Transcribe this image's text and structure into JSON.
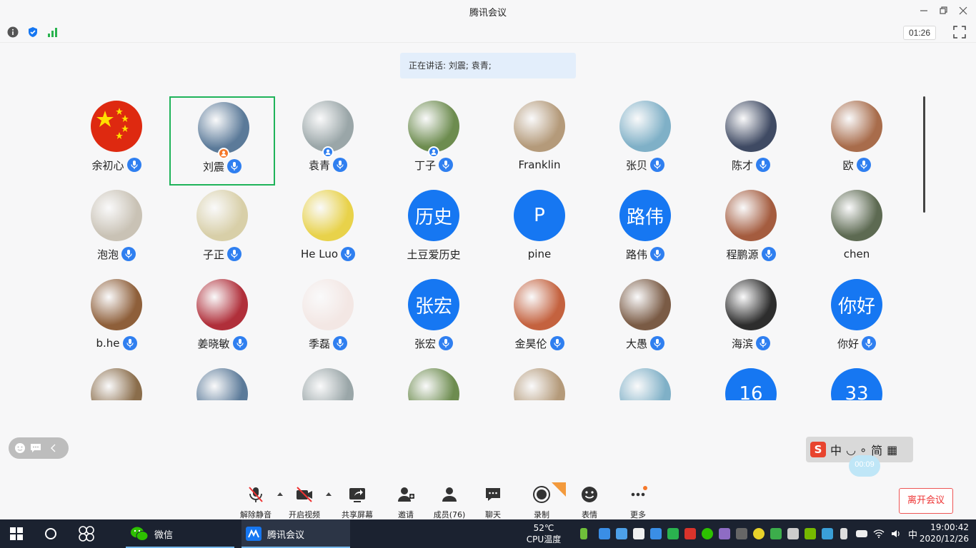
{
  "window": {
    "title": "腾讯会议"
  },
  "status": {
    "timer": "01:26"
  },
  "speaking": {
    "text": "正在讲话: 刘震; 袁青;"
  },
  "participants": [
    {
      "name": "余初心",
      "avatar": "flag",
      "mic": true
    },
    {
      "name": "刘震",
      "avatar": "photo",
      "mic": true,
      "active": true,
      "host": true
    },
    {
      "name": "袁青",
      "avatar": "photo",
      "mic": true,
      "cohost": true
    },
    {
      "name": "丁子",
      "avatar": "photo",
      "mic": true,
      "cohost": true
    },
    {
      "name": "Franklin",
      "avatar": "photo",
      "mic": false
    },
    {
      "name": "张贝",
      "avatar": "photo",
      "mic": true
    },
    {
      "name": "陈才",
      "avatar": "photo",
      "mic": true
    },
    {
      "name": "欧",
      "avatar": "photo",
      "mic": true
    },
    {
      "name": "泡泡",
      "avatar": "photo",
      "mic": true
    },
    {
      "name": "子正",
      "avatar": "photo",
      "mic": true
    },
    {
      "name": "He Luo",
      "avatar": "photo",
      "mic": true
    },
    {
      "name": "土豆爱历史",
      "avatar": "text",
      "initials": "历史",
      "mic": false
    },
    {
      "name": "pine",
      "avatar": "text",
      "initials": "P",
      "mic": false
    },
    {
      "name": "路伟",
      "avatar": "text",
      "initials": "路伟",
      "mic": true
    },
    {
      "name": "程鹏源",
      "avatar": "photo",
      "mic": true
    },
    {
      "name": "chen",
      "avatar": "photo",
      "mic": false
    },
    {
      "name": "b.he",
      "avatar": "photo",
      "mic": true
    },
    {
      "name": "姜晓敏",
      "avatar": "photo",
      "mic": true
    },
    {
      "name": "季磊",
      "avatar": "photo",
      "mic": true
    },
    {
      "name": "张宏",
      "avatar": "text",
      "initials": "张宏",
      "mic": true
    },
    {
      "name": "金昊伦",
      "avatar": "photo",
      "mic": true
    },
    {
      "name": "大愚",
      "avatar": "photo",
      "mic": true
    },
    {
      "name": "海滨",
      "avatar": "photo",
      "mic": true
    },
    {
      "name": "你好",
      "avatar": "text",
      "initials": "你好",
      "mic": true
    },
    {
      "name": "",
      "avatar": "photo",
      "mic": false
    },
    {
      "name": "",
      "avatar": "photo",
      "mic": false
    },
    {
      "name": "",
      "avatar": "photo",
      "mic": false
    },
    {
      "name": "",
      "avatar": "photo",
      "mic": false
    },
    {
      "name": "",
      "avatar": "photo",
      "mic": false
    },
    {
      "name": "",
      "avatar": "photo",
      "mic": false
    },
    {
      "name": "",
      "avatar": "text",
      "initials": "16",
      "mic": false
    },
    {
      "name": "",
      "avatar": "text",
      "initials": "33",
      "mic": false
    }
  ],
  "toolbar": {
    "unmute": "解除静音",
    "video": "开启视频",
    "share": "共享屏幕",
    "invite": "邀请",
    "members": "成员(76)",
    "chat": "聊天",
    "record": "录制",
    "emoji": "表情",
    "more": "更多",
    "leave": "离开会议"
  },
  "ime": {
    "mode": "中",
    "mark": "简"
  },
  "float_timer": "00:09",
  "taskbar": {
    "app1": "微信",
    "app2": "腾讯会议",
    "cpu_temp": "52℃",
    "cpu_label": "CPU温度",
    "ime": "中",
    "time": "19:00:42",
    "date": "2020/12/26"
  },
  "colors": {
    "accent": "#1677f2",
    "active_border": "#1fb35a",
    "leave": "#e33333",
    "taskbar": "#1b2230"
  }
}
